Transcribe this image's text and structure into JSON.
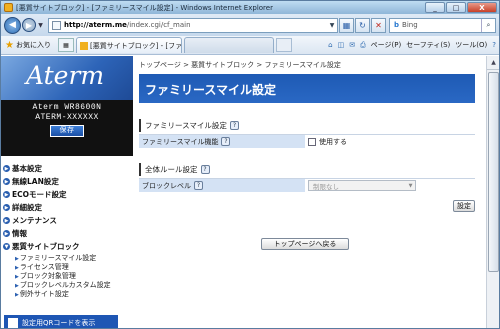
{
  "window": {
    "title": "[悪質サイトブロック] - [ファミリースマイル設定] - Windows Internet Explorer",
    "minimize_glyph": "_",
    "maximize_glyph": "□",
    "close_glyph": "X"
  },
  "address": {
    "host": "http://aterm.me",
    "path": "/index.cgi/cf_main",
    "search_placeholder": "Bing",
    "back_glyph": "◀",
    "forward_glyph": "▶",
    "refresh_glyph": "↻",
    "stop_glyph": "✕",
    "search_glyph": "⌕"
  },
  "favorites": {
    "label": "お気に入り",
    "tabs": [
      {
        "label": "[悪質サイトブロック] - [ファミリース..."
      },
      {
        "label": ""
      }
    ],
    "tools": [
      "ページ(P)",
      "セーフティ(S)",
      "ツール(O)"
    ],
    "help_glyph": "?"
  },
  "sidebar": {
    "logo": "Aterm",
    "model_line1": "Aterm WR8600N",
    "model_line2": "ATERM-XXXXXX",
    "save_label": "保存",
    "menu": [
      {
        "label": "基本設定"
      },
      {
        "label": "無線LAN設定"
      },
      {
        "label": "ECOモード設定"
      },
      {
        "label": "詳細設定"
      },
      {
        "label": "メンテナンス"
      },
      {
        "label": "情報"
      },
      {
        "label": "悪質サイトブロック"
      }
    ],
    "submenu": [
      {
        "label": "ファミリースマイル設定"
      },
      {
        "label": "ライセンス管理"
      },
      {
        "label": "ブロック対象管理"
      },
      {
        "label": "ブロックレベルカスタム設定"
      },
      {
        "label": "例外サイト設定"
      }
    ],
    "qr_label": "設定用QRコードを表示"
  },
  "main": {
    "breadcrumb": "トップページ > 悪質サイトブロック > ファミリースマイル設定",
    "page_title": "ファミリースマイル設定",
    "section1": {
      "title": "ファミリースマイル設定",
      "row_label": "ファミリースマイル機能",
      "checkbox_label": "使用する"
    },
    "section2": {
      "title": "全体ルール設定",
      "row_label": "ブロックレベル",
      "select_value": "制限なし",
      "apply_label": "設定"
    },
    "back_button": "トップページへ戻る",
    "help_glyph": "?"
  }
}
